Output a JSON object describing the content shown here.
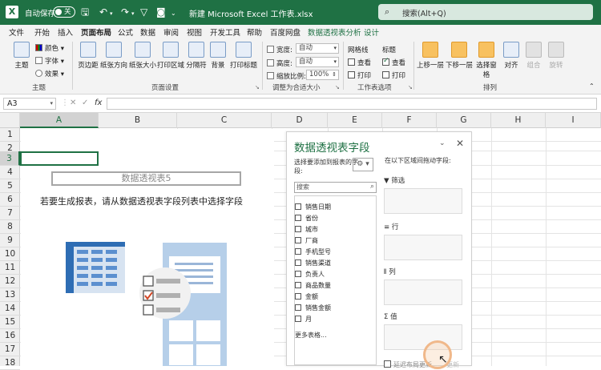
{
  "titlebar": {
    "logo": "X",
    "autosave_label": "自动保存",
    "autosave_state": "关",
    "doc_title": "新建 Microsoft Excel 工作表.xlsx",
    "search_placeholder": "搜索(Alt+Q)"
  },
  "menu": {
    "tabs": [
      "文件",
      "开始",
      "插入",
      "页面布局",
      "公式",
      "数据",
      "审阅",
      "视图",
      "开发工具",
      "帮助",
      "百度网盘",
      "数据透视表分析",
      "设计"
    ],
    "active": "页面布局"
  },
  "ribbon": {
    "theme": {
      "big_label": "主题",
      "colors": "颜色",
      "fonts": "字体",
      "effects": "效果",
      "group": "主题"
    },
    "page_setup": {
      "margins": "页边距",
      "orientation": "纸张方向",
      "size": "纸张大小",
      "print_area": "打印区域",
      "breaks": "分隔符",
      "background": "背景",
      "print_titles": "打印标题",
      "group": "页面设置"
    },
    "scale": {
      "width_label": "宽度:",
      "width_value": "自动",
      "height_label": "高度:",
      "height_value": "自动",
      "scale_label": "缩放比例:",
      "scale_value": "100%",
      "group": "调整为合适大小"
    },
    "sheet_options": {
      "gridlines": "网格线",
      "headings": "标题",
      "view": "查看",
      "print": "打印",
      "group": "工作表选项"
    },
    "arrange": {
      "bring_forward": "上移一层",
      "send_backward": "下移一层",
      "selection_pane": "选择窗格",
      "align": "对齐",
      "group_btn": "组合",
      "rotate": "旋转",
      "group": "排列"
    }
  },
  "formula_bar": {
    "name_box": "A3",
    "fx": "fx",
    "value": ""
  },
  "grid": {
    "columns": [
      "A",
      "B",
      "C",
      "D",
      "E",
      "F",
      "G",
      "H",
      "I"
    ],
    "rows": [
      "1",
      "2",
      "3",
      "4",
      "5",
      "6",
      "7",
      "8",
      "9",
      "10",
      "11",
      "12",
      "13",
      "14",
      "15",
      "16",
      "17",
      "18"
    ],
    "selected_cell": "A3"
  },
  "pivot_placeholder": {
    "name": "数据透视表5",
    "message": "若要生成报表，请从数据透视表字段列表中选择字段"
  },
  "pivot_pane": {
    "title": "数据透视表字段",
    "choose_label": "选择要添加到报表的字段:",
    "drag_label": "在以下区域间拖动字段:",
    "search_placeholder": "搜索",
    "fields": [
      "销售日期",
      "省份",
      "城市",
      "厂商",
      "手机型号",
      "销售渠道",
      "负责人",
      "商品数量",
      "金额",
      "销售金额",
      "月"
    ],
    "more_tables": "更多表格...",
    "areas": [
      "筛选",
      "行",
      "列",
      "值"
    ],
    "defer_label": "延迟布局更新",
    "update_label": "更新"
  }
}
